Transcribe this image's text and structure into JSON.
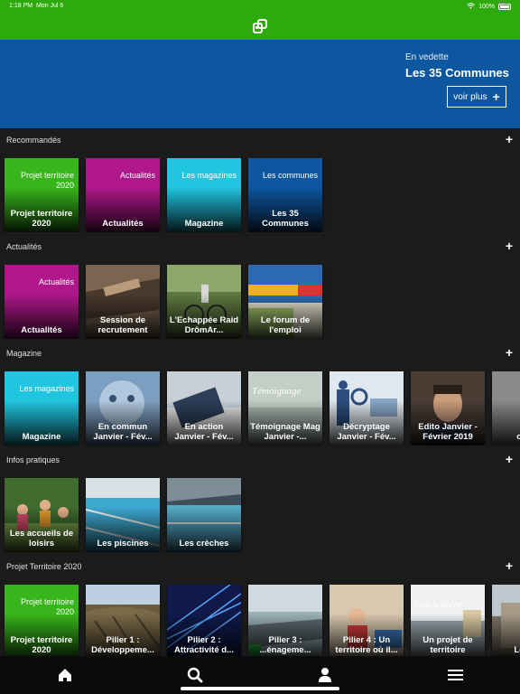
{
  "status": {
    "time": "1:18 PM",
    "date": "Mon Jul 6",
    "battery": "100%"
  },
  "banner": {
    "kicker": "En vedette",
    "headline": "Les 35 Communes",
    "button": "voir plus"
  },
  "sections": [
    {
      "title": "Recommandés",
      "tiles": [
        {
          "tag": "Projet territoire 2020",
          "label": "Projet territoire 2020",
          "color": "#38b51a"
        },
        {
          "tag": "Actualités",
          "label": "Actualités",
          "color": "#b0178b"
        },
        {
          "tag": "Les magazines",
          "label": "Magazine",
          "color": "#20c6e0"
        },
        {
          "tag": "Les communes",
          "label": "Les 35 Communes",
          "color": "#0d57a0"
        }
      ]
    },
    {
      "title": "Actualités",
      "tiles": [
        {
          "tag": "Actualités",
          "label": "Actualités",
          "color": "#b0178b"
        },
        {
          "tag": "",
          "label": "Session de recrutement",
          "color": "#6e5a48",
          "photo": "leather"
        },
        {
          "tag": "",
          "label": "L'Echappée Raid DrômAr...",
          "color": "#4f6a32",
          "photo": "bike"
        },
        {
          "tag": "",
          "label": "Le forum de l'emploi",
          "color": "#2e6fb0",
          "photo": "poster"
        }
      ]
    },
    {
      "title": "Magazine",
      "tiles": [
        {
          "tag": "Les magazines",
          "label": "Magazine",
          "color": "#20c6e0"
        },
        {
          "tag": "",
          "label": "En commun Janvier - Fév...",
          "color": "#6f8fb0",
          "photo": "mosaic"
        },
        {
          "tag": "",
          "label": "En action Janvier - Fév...",
          "color": "#7a8da0",
          "photo": "desk"
        },
        {
          "tag": "",
          "label": "Témoignage Mag Janvier -...",
          "color": "#8fa49a",
          "photo": "temoignage",
          "overlay": "Témoignage"
        },
        {
          "tag": "",
          "label": "Décryptage Janvier - Fév...",
          "color": "#c7d6e0",
          "photo": "illustration"
        },
        {
          "tag": "",
          "label": "Edito Janvier - Février 2019",
          "color": "#5b4a3e",
          "photo": "portrait"
        },
        {
          "tag": "",
          "label": "conce",
          "color": "#8c8c8c",
          "photo": "plain"
        }
      ]
    },
    {
      "title": "Infos pratiques",
      "tiles": [
        {
          "tag": "",
          "label": "Les accueils de loisirs",
          "color": "#3b6d2e",
          "photo": "kids"
        },
        {
          "tag": "",
          "label": "Les piscines",
          "color": "#3da0c5",
          "photo": "pool"
        },
        {
          "tag": "",
          "label": "Les crèches",
          "color": "#4aa0c0",
          "photo": "pool2"
        }
      ]
    },
    {
      "title": "Projet Territoire 2020",
      "tiles": [
        {
          "tag": "Projet territoire 2020",
          "label": "Projet territoire 2020",
          "color": "#38b51a"
        },
        {
          "tag": "",
          "label": "Pilier 1 : Développeme...",
          "color": "#6c5a3c",
          "photo": "field"
        },
        {
          "tag": "",
          "label": "Pilier 2 : Attractivité d...",
          "color": "#1b2d6e",
          "photo": "fiber"
        },
        {
          "tag": "",
          "label": "Pilier 3 : ...énageme...",
          "color": "#7f9095",
          "photo": "road"
        },
        {
          "tag": "",
          "label": "Pilier 4 : Un territoire où il...",
          "color": "#b7a38a",
          "photo": "classroom"
        },
        {
          "tag": "",
          "label": "Un projet de territoire",
          "color": "#dfe3e6",
          "photo": "drome",
          "overlay": "rômArdèche"
        },
        {
          "tag": "",
          "label": "Le com",
          "color": "#7c7365",
          "photo": "building"
        }
      ]
    }
  ],
  "tabs": [
    "home-icon",
    "search-icon",
    "person-icon",
    "menu-icon"
  ]
}
